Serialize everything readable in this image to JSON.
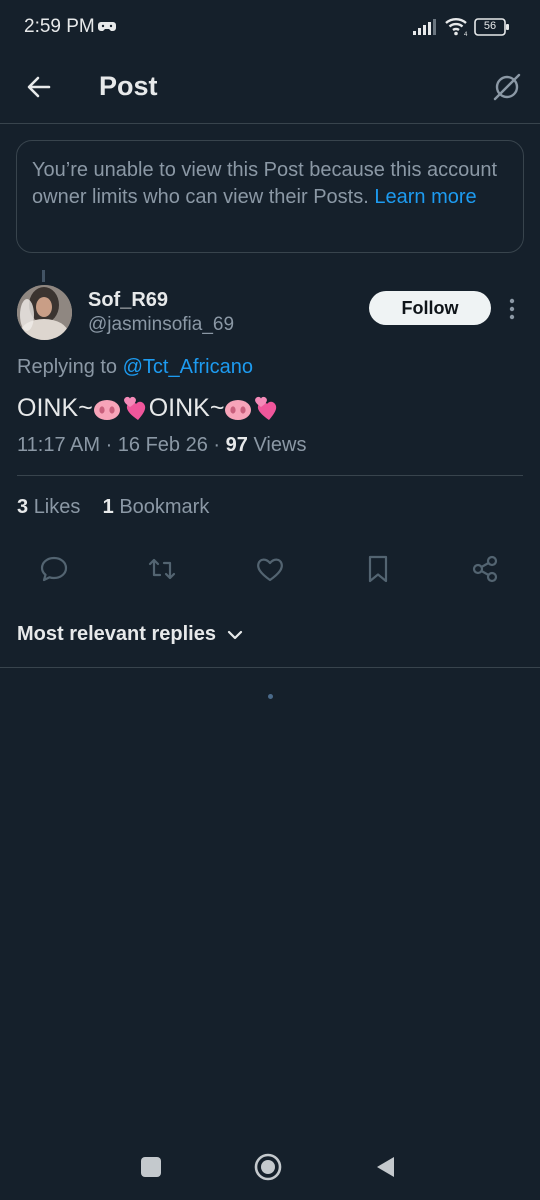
{
  "status_bar": {
    "time": "2:59 PM",
    "battery": "56"
  },
  "header": {
    "title": "Post"
  },
  "notice": {
    "text": "You’re unable to view this Post because this account owner limits who can view their Posts.",
    "link": "Learn more"
  },
  "tweet": {
    "display_name": "Sof_R69",
    "handle": "@jasminsofia_69",
    "follow_label": "Follow",
    "replying_prefix": "Replying to",
    "replying_target": "@Tct_Africano",
    "text_part1": "OINK~",
    "text_part2": "OINK~",
    "time": "11:17 AM · 16 Feb 26 · ",
    "views_count": "97",
    "views_label": "Views",
    "likes_count": "3",
    "likes_label": "Likes",
    "bookmarks_count": "1",
    "bookmarks_label": "Bookmark"
  },
  "replies": {
    "sort_label": "Most relevant replies"
  },
  "icons": {
    "back": "back-arrow-icon",
    "grok": "grok-icon",
    "more": "more-vertical-icon",
    "reply": "reply-icon",
    "retweet": "retweet-icon",
    "like": "heart-icon",
    "bookmark": "bookmark-icon",
    "share": "share-icon",
    "emoji1": "pig-nose-emoji",
    "emoji2": "two-hearts-emoji"
  },
  "colors": {
    "background": "#15202b",
    "accent": "#1d9bf0",
    "text_primary": "#e7e9ea",
    "text_secondary": "#8b98a5",
    "border": "#38444d"
  }
}
